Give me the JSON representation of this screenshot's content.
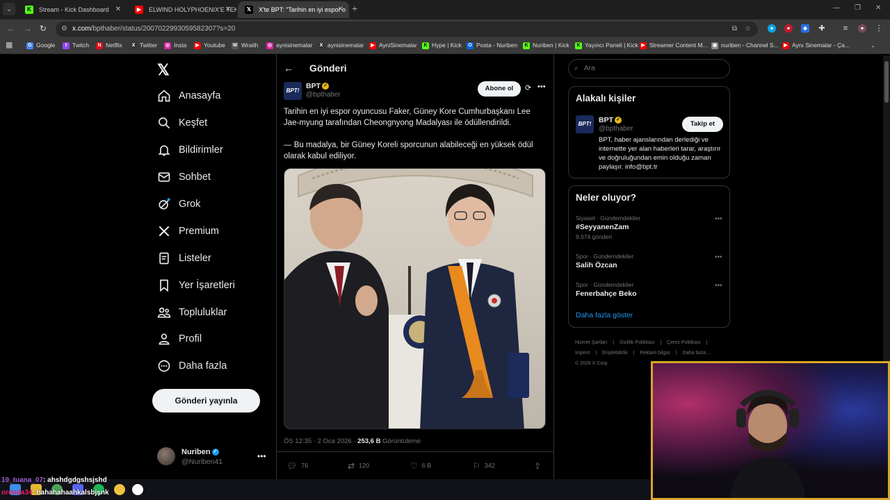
{
  "browser": {
    "tabs": [
      {
        "title": "Stream - Kick Dashboard",
        "icon": "kick-icon",
        "color": "#53fc18"
      },
      {
        "title": "ELWIND HOLYPHOENIX'E TEK A",
        "icon": "youtube-icon",
        "color": "#ff0000"
      },
      {
        "title": "X'te BPT: \"Tarihin en iyi espor o",
        "icon": "x-icon",
        "color": "#ffffff"
      }
    ],
    "url_domain": "x.com",
    "url_path": "/bpthaber/status/2007022993059582307?s=20",
    "bookmarks": [
      {
        "label": "Google",
        "icon": "google-icon",
        "color": "#4285f4"
      },
      {
        "label": "Twitch",
        "icon": "twitch-icon",
        "color": "#9146ff"
      },
      {
        "label": "Netflix",
        "icon": "netflix-icon",
        "color": "#e50914"
      },
      {
        "label": "Twitter",
        "icon": "x-icon",
        "color": "#333333"
      },
      {
        "label": "Insta",
        "icon": "instagram-icon",
        "color": "#d6249f"
      },
      {
        "label": "Youtube",
        "icon": "youtube-icon",
        "color": "#ff0000"
      },
      {
        "label": "Wraith",
        "icon": "wraith-icon",
        "color": "#555555"
      },
      {
        "label": "aynisinemalar",
        "icon": "instagram-icon",
        "color": "#d6249f"
      },
      {
        "label": "aynisinemalar",
        "icon": "x-icon",
        "color": "#333333"
      },
      {
        "label": "AyniSinemalar",
        "icon": "youtube-icon",
        "color": "#ff0000"
      },
      {
        "label": "Hype | Kick",
        "icon": "kick-icon",
        "color": "#53fc18"
      },
      {
        "label": "Posta - Nuriben",
        "icon": "outlook-icon",
        "color": "#0a64d8"
      },
      {
        "label": "Nuriben | Kick",
        "icon": "kick-icon",
        "color": "#53fc18"
      },
      {
        "label": "Yayıncı Paneli | Kick",
        "icon": "kick-icon",
        "color": "#53fc18"
      },
      {
        "label": "Streamer Content M...",
        "icon": "youtube-icon",
        "color": "#ff0000"
      },
      {
        "label": "nuriben - Channel S...",
        "icon": "youtube-studio-icon",
        "color": "#888888"
      },
      {
        "label": "Aynı Sinemalar - Ça...",
        "icon": "youtube-icon",
        "color": "#ff0000"
      }
    ]
  },
  "nav": {
    "items": [
      {
        "label": "Anasayfa",
        "icon": "home-icon"
      },
      {
        "label": "Keşfet",
        "icon": "search-icon"
      },
      {
        "label": "Bildirimler",
        "icon": "bell-icon"
      },
      {
        "label": "Sohbet",
        "icon": "mail-icon"
      },
      {
        "label": "Grok",
        "icon": "grok-icon"
      },
      {
        "label": "Premium",
        "icon": "x-icon"
      },
      {
        "label": "Listeler",
        "icon": "list-icon"
      },
      {
        "label": "Yer İşaretleri",
        "icon": "bookmark-icon"
      },
      {
        "label": "Topluluklar",
        "icon": "people-icon"
      },
      {
        "label": "Profil",
        "icon": "person-icon"
      },
      {
        "label": "Daha fazla",
        "icon": "more-circle-icon"
      }
    ],
    "post_button": "Gönderi yayınla",
    "account": {
      "name": "Nuriben",
      "handle": "@Nuriben41"
    }
  },
  "post": {
    "header_title": "Gönderi",
    "author_name": "BPT",
    "author_handle": "@bpthaber",
    "avatar_text": "BPT!",
    "subscribe_label": "Abone ol",
    "paragraphs": [
      "Tarihin en iyi espor oyuncusu Faker, Güney Kore Cumhurbaşkanı Lee Jae-myung tarafından Cheongnyong Madalyası ile ödüllendirildi.",
      "— Bu madalya, bir Güney Koreli sporcunun alabileceği en yüksek ödül olarak kabul ediliyor."
    ],
    "time": "ÖS 12:35 · 2 Oca 2026 · ",
    "views_count": "253,6 B",
    "views_label": " Görüntüleme",
    "stats": {
      "replies": "76",
      "reposts": "120",
      "likes": "6 B",
      "bookmarks": "342"
    }
  },
  "sidebar": {
    "search_placeholder": "Ara",
    "relevant_title": "Alakalı kişiler",
    "relevant": {
      "name": "BPT",
      "handle": "@bpthaber",
      "follow_label": "Takip et",
      "bio": "BPT, haber ajanslarından derlediği ve internette yer alan haberleri tarar, araştırır ve doğruluğundan emin olduğu zaman paylaşır. info@bpt.tr"
    },
    "trends_title": "Neler oluyor?",
    "trends": [
      {
        "category": "Siyaset · Gündemdekiler",
        "name": "#SeyyanenZam",
        "count": "9.074 gönderi"
      },
      {
        "category": "Spor · Gündemdekiler",
        "name": "Salih Özcan",
        "count": ""
      },
      {
        "category": "Spor · Gündemdekiler",
        "name": "Fenerbahçe Beko",
        "count": ""
      }
    ],
    "show_more": "Daha fazla göster",
    "footer": [
      "Hizmet Şartları",
      "|",
      "Gizlilik Politikası",
      "|",
      "Çerez Politikası",
      "|",
      "Imprint",
      "|",
      "Erişilebilirlik",
      "|",
      "Reklam bilgisi",
      "|",
      "Daha fazla ...",
      "© 2026 X Corp."
    ]
  },
  "overlay": {
    "chat": [
      {
        "user": "19_tuana_07",
        "message": ": ahshdgdgshsjshd"
      },
      {
        "user": "orenda34",
        "message": ": hahahahaahkalsbjşnk"
      }
    ]
  }
}
